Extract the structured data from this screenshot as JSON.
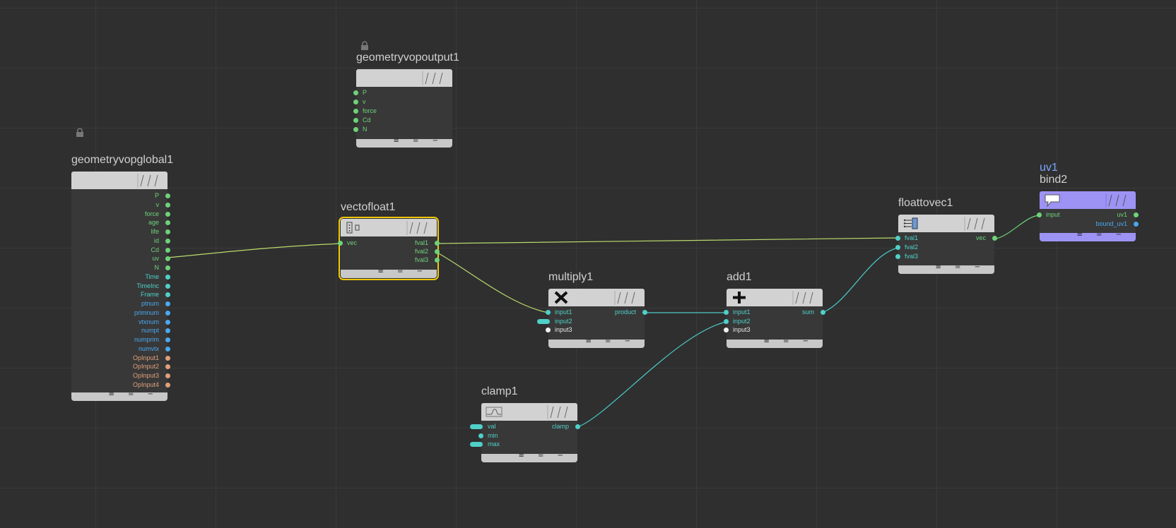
{
  "colors": {
    "background": "#2f2f2f",
    "wire_green": "#b8dc6c",
    "wire_cyan": "#4cc8c8",
    "port_green": "#6ed27a",
    "port_cyan": "#4fd0c8",
    "port_blue": "#4aa8f0",
    "port_orange": "#e0a07a",
    "bind_purple": "#9d93f4",
    "selection_yellow": "#f2c80a"
  },
  "footer_controls": "≡ = −",
  "nodes": {
    "global": {
      "name": "geometryvopglobal1",
      "locked": true,
      "outputs": [
        "P",
        "v",
        "force",
        "age",
        "life",
        "id",
        "Cd",
        "uv",
        "N",
        "Time",
        "TimeInc",
        "Frame",
        "ptnum",
        "primnum",
        "vtxnum",
        "numpt",
        "numprim",
        "numvtx",
        "OpInput1",
        "OpInput2",
        "OpInput3",
        "OpInput4"
      ]
    },
    "output": {
      "name": "geometryvopoutput1",
      "locked": true,
      "inputs": [
        "P",
        "v",
        "force",
        "Cd",
        "N"
      ]
    },
    "vectofloat": {
      "name": "vectofloat1",
      "selected": true,
      "inputs": [
        "vec"
      ],
      "outputs": [
        "fval1",
        "fval2",
        "fval3"
      ]
    },
    "multiply": {
      "name": "multiply1",
      "icon": "multiply-icon",
      "inputs": [
        "input1",
        "input2",
        "input3"
      ],
      "outputs": [
        "product"
      ]
    },
    "add": {
      "name": "add1",
      "icon": "plus-icon",
      "inputs": [
        "input1",
        "input2",
        "input3"
      ],
      "outputs": [
        "sum"
      ]
    },
    "clamp": {
      "name": "clamp1",
      "icon": "clamp-curve-icon",
      "inputs": [
        "val",
        "min",
        "max"
      ],
      "outputs": [
        "clamp"
      ]
    },
    "floattovec": {
      "name": "floattovec1",
      "icon": "merge-stack-icon",
      "inputs": [
        "fval1",
        "fval2",
        "fval3"
      ],
      "outputs": [
        "vec"
      ]
    },
    "bind": {
      "label": "uv1",
      "name": "bind2",
      "icon": "speech-bubble-icon",
      "inputs": [
        "input"
      ],
      "outputs": [
        "uv1",
        "bound_uv1"
      ]
    }
  }
}
